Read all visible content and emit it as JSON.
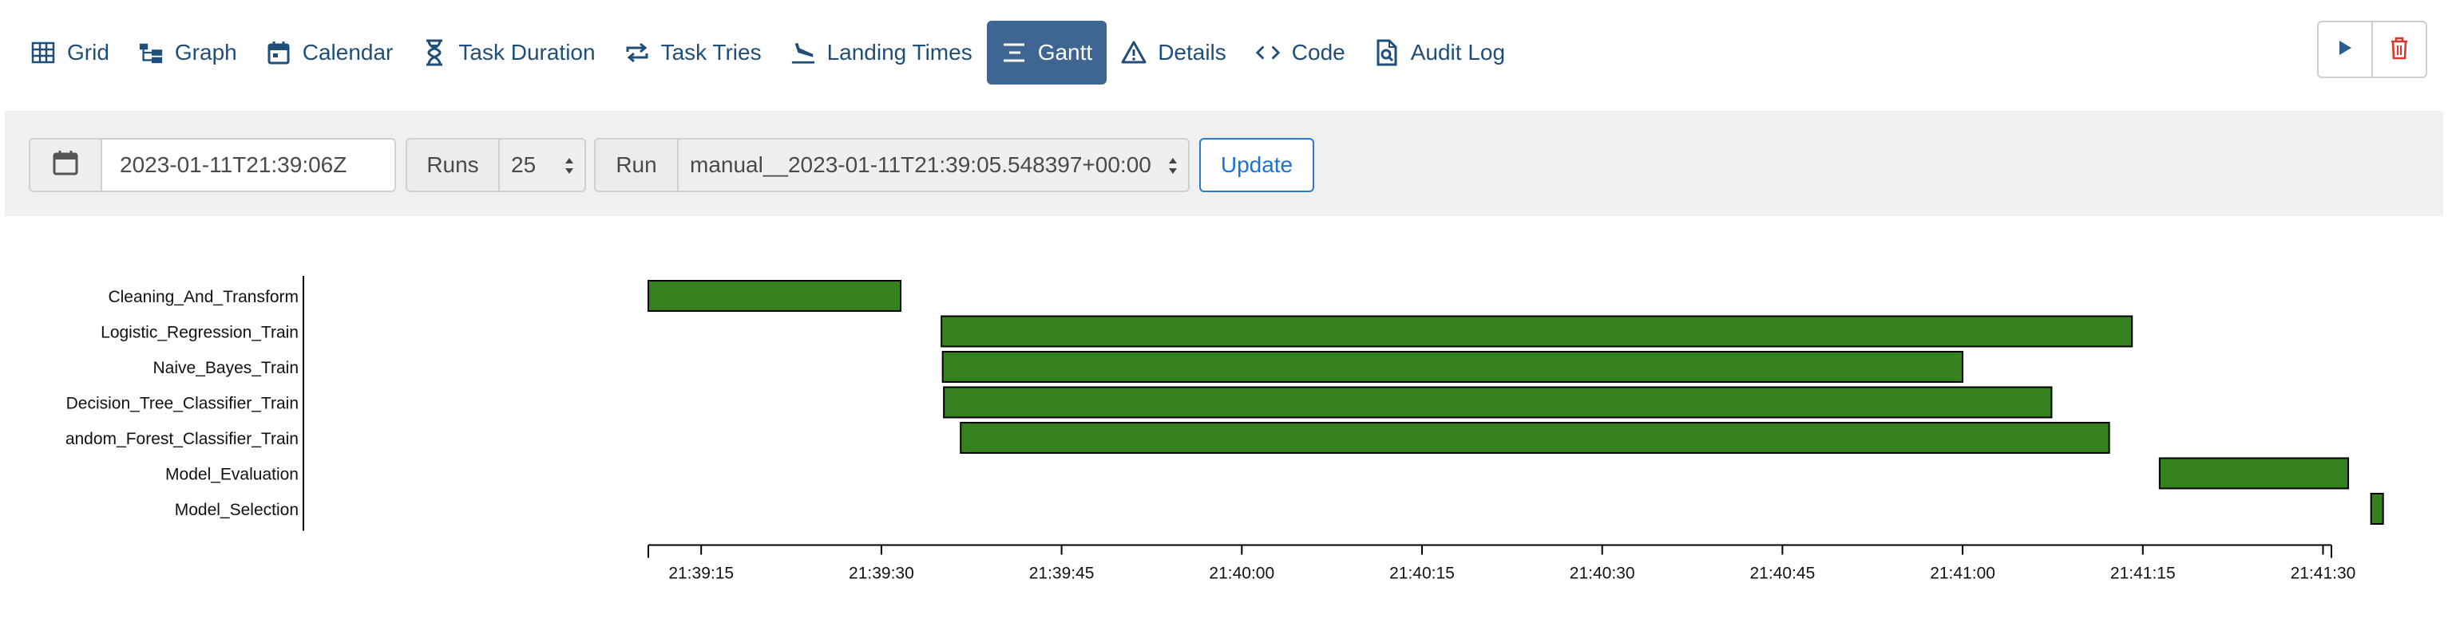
{
  "nav": {
    "tabs": [
      {
        "label": "Grid",
        "icon": "grid-icon",
        "active": false
      },
      {
        "label": "Graph",
        "icon": "graph-icon",
        "active": false
      },
      {
        "label": "Calendar",
        "icon": "calendar-icon",
        "active": false
      },
      {
        "label": "Task Duration",
        "icon": "hourglass-icon",
        "active": false
      },
      {
        "label": "Task Tries",
        "icon": "retry-icon",
        "active": false
      },
      {
        "label": "Landing Times",
        "icon": "plane-landing-icon",
        "active": false
      },
      {
        "label": "Gantt",
        "icon": "gantt-icon",
        "active": true
      },
      {
        "label": "Details",
        "icon": "warning-triangle-icon",
        "active": false
      },
      {
        "label": "Code",
        "icon": "code-icon",
        "active": false
      },
      {
        "label": "Audit Log",
        "icon": "file-search-icon",
        "active": false
      }
    ],
    "actions": {
      "trigger_icon": "play-icon",
      "delete_icon": "trash-icon"
    }
  },
  "form": {
    "date_value": "2023-01-11T21:39:06Z",
    "runs_label": "Runs",
    "runs_value": "25",
    "run_label": "Run",
    "run_value": "manual__2023-01-11T21:39:05.548397+00:00",
    "update_label": "Update"
  },
  "colors": {
    "bar_fill": "#35811f",
    "bar_stroke": "#000000",
    "accent": "#3f6592",
    "link": "#1f4e79"
  },
  "chart_data": {
    "type": "gantt",
    "x_axis": "time",
    "xlim": [
      "21:39:10.6",
      "21:41:30.7"
    ],
    "ticks": [
      "21:39:15",
      "21:39:30",
      "21:39:45",
      "21:40:00",
      "21:40:15",
      "21:40:30",
      "21:40:45",
      "21:41:00",
      "21:41:15",
      "21:41:30"
    ],
    "tasks": [
      {
        "name": "Cleaning_And_Transform",
        "start": "21:39:10.6",
        "end": "21:39:31.6"
      },
      {
        "name": "Logistic_Regression_Train",
        "start": "21:39:35.0",
        "end": "21:41:14.1"
      },
      {
        "name": "Naive_Bayes_Train",
        "start": "21:39:35.1",
        "end": "21:41:00.0"
      },
      {
        "name": "Decision_Tree_Classifier_Train",
        "start": "21:39:35.2",
        "end": "21:41:07.4"
      },
      {
        "name": "andom_Forest_Classifier_Train",
        "start": "21:39:36.6",
        "end": "21:41:12.2"
      },
      {
        "name": "Model_Evaluation",
        "start": "21:41:16.4",
        "end": "21:41:32.1"
      },
      {
        "name": "Model_Selection",
        "start": "21:41:34.0",
        "end": "21:41:35.0"
      }
    ]
  }
}
